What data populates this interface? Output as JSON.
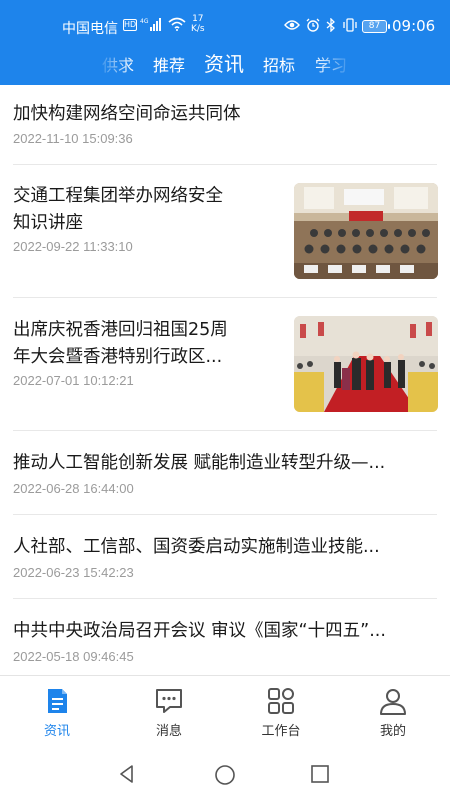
{
  "status_bar": {
    "carrier": "中国电信",
    "hd": "HD",
    "net_type": "4G",
    "speed_value": "17",
    "speed_unit": "K/s",
    "battery": "87",
    "time": "09:06"
  },
  "tabs": [
    {
      "label": "供求",
      "active": false
    },
    {
      "label": "推荐",
      "active": false
    },
    {
      "label": "资讯",
      "active": true
    },
    {
      "label": "招标",
      "active": false
    },
    {
      "label": "学习",
      "active": false
    }
  ],
  "news": [
    {
      "title_lines": [
        "加快构建网络空间命运共同体"
      ],
      "date": "2022-11-10 15:09:36",
      "has_image": false
    },
    {
      "title_lines": [
        "交通工程集团举办网络安全",
        "知识讲座"
      ],
      "date": "2022-09-22 11:33:10",
      "has_image": true,
      "image": "conference-room-photo"
    },
    {
      "title_lines": [
        "出席庆祝香港回归祖国25周",
        "年大会暨香港特别行政区..."
      ],
      "date": "2022-07-01 10:12:21",
      "has_image": true,
      "image": "ceremony-red-carpet-photo"
    },
    {
      "title_lines": [
        "推动人工智能创新发展 赋能制造业转型升级—..."
      ],
      "date": "2022-06-28 16:44:00",
      "has_image": false
    },
    {
      "title_lines": [
        "人社部、工信部、国资委启动实施制造业技能..."
      ],
      "date": "2022-06-23 15:42:23",
      "has_image": false
    },
    {
      "title_lines": [
        "中共中央政治局召开会议 审议《国家“十四五”..."
      ],
      "date": "2022-05-18 09:46:45",
      "has_image": false
    }
  ],
  "bottom_nav": [
    {
      "label": "资讯",
      "icon": "news-document-icon",
      "active": true
    },
    {
      "label": "消息",
      "icon": "message-bubble-icon",
      "active": false
    },
    {
      "label": "工作台",
      "icon": "workbench-grid-icon",
      "active": false
    },
    {
      "label": "我的",
      "icon": "profile-person-icon",
      "active": false
    }
  ],
  "colors": {
    "accent": "#1E84EB",
    "text": "#1a1a1a",
    "muted": "#9b9b9b"
  },
  "system_nav": [
    "back-icon",
    "home-icon",
    "recents-icon"
  ]
}
